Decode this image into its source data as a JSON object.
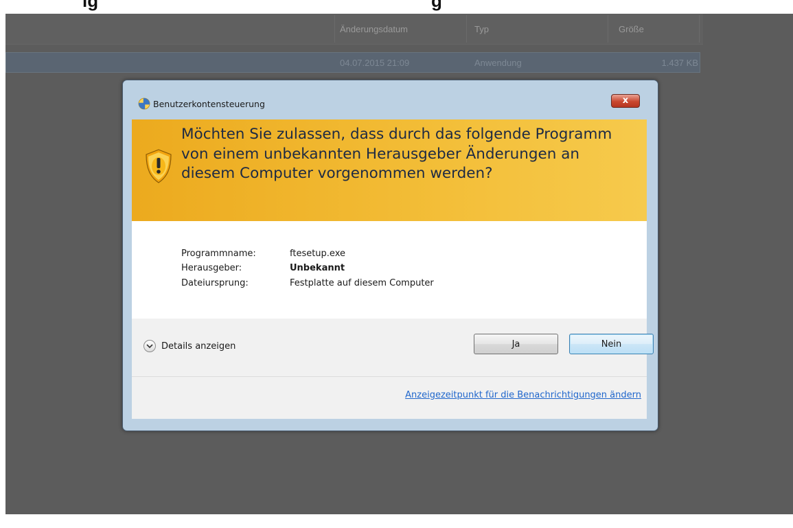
{
  "caption": {
    "left_fragment": "ig",
    "right_fragment": "g"
  },
  "explorer": {
    "columns": [
      "Änderungsdatum",
      "Typ",
      "Größe"
    ],
    "file_row": {
      "date": "04.07.2015 21:09",
      "type": "Anwendung",
      "size": "1.437 KB"
    }
  },
  "dialog": {
    "title": "Benutzerkontensteuerung",
    "close_label": "x",
    "question": "Möchten Sie zulassen, dass durch das folgende Programm von einem unbekannten Herausgeber Änderungen an diesem Computer vorgenommen werden?",
    "fields": [
      {
        "label": "Programmname:",
        "value": "ftesetup.exe"
      },
      {
        "label": "Herausgeber:",
        "value": "Unbekannt"
      },
      {
        "label": "Dateiursprung:",
        "value": "Festplatte auf diesem Computer"
      }
    ],
    "details_label": "Details anzeigen",
    "yes_label": "Ja",
    "no_label": "Nein",
    "notify_link": "Anzeigezeitpunkt für die Benachrichtigungen ändern"
  },
  "icons": {
    "title": "uac-shield-icon",
    "banner": "warning-shield-icon",
    "details": "chevron-down-icon"
  },
  "colors": {
    "banner": "#f0b52c",
    "link": "#1f66cc",
    "close_button": "#c9472f"
  }
}
